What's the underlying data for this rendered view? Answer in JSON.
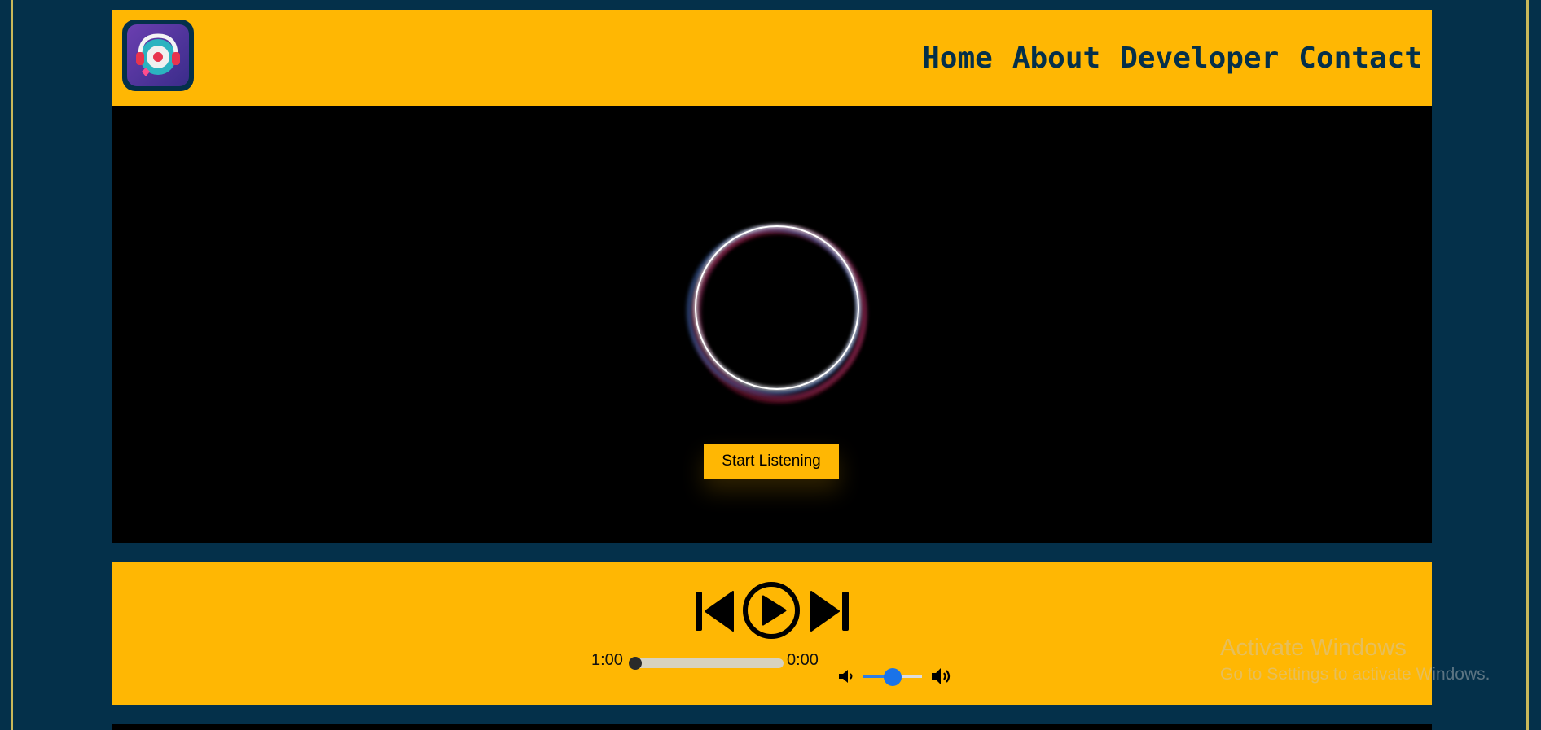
{
  "nav": {
    "items": [
      {
        "label": "Home"
      },
      {
        "label": "About"
      },
      {
        "label": "Developer"
      },
      {
        "label": "Contact"
      }
    ]
  },
  "stage": {
    "start_button": "Start Listening"
  },
  "player": {
    "current_time": "1:00",
    "total_time": "0:00",
    "progress_fraction": 0.0,
    "volume_fraction": 0.5,
    "icons": [
      "prev-icon",
      "play-icon",
      "next-icon",
      "volume-low-icon",
      "volume-high-icon"
    ]
  },
  "watermark": {
    "line1": "Activate Windows",
    "line2": "Go to Settings to activate Windows."
  },
  "colors": {
    "accent": "#ffb703",
    "background": "#04304a",
    "stage": "#000000"
  }
}
